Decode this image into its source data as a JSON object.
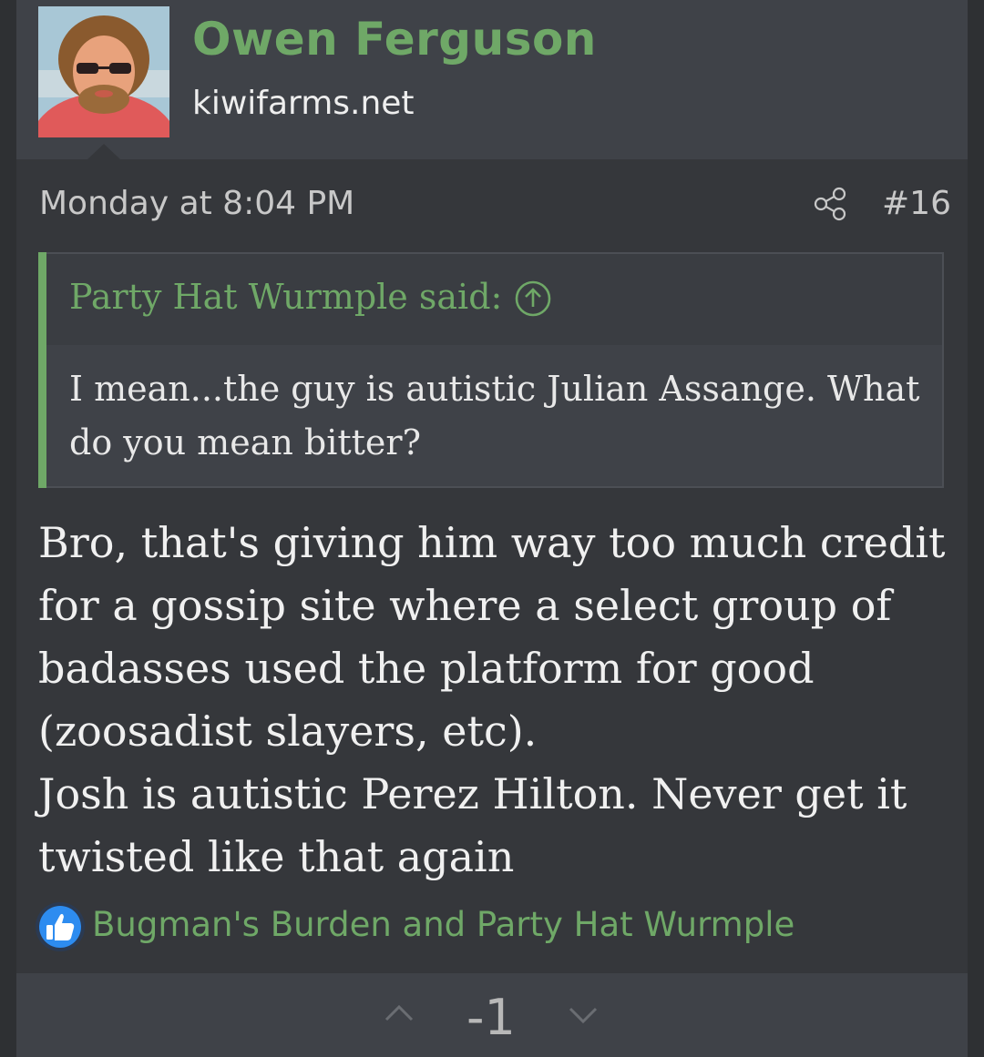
{
  "author": {
    "name": "Owen Ferguson",
    "title": "kiwifarms.net"
  },
  "post": {
    "date": "Monday at 8:04 PM",
    "number": "#16"
  },
  "quote": {
    "author_line": "Party Hat Wurmple said:",
    "text": "I mean...the guy is autistic Julian Assange. What do you mean bitter?"
  },
  "body": {
    "paragraph_1": "Bro, that's giving him way too much credit for a gossip site where a select group of badasses used the platform for good (zoosadist slayers, etc).",
    "paragraph_2": "Josh is autistic Perez Hilton. Never get it twisted like that again"
  },
  "reactions": {
    "icon": "thumbs-up-icon",
    "users": "Bugman's Burden and Party Hat Wurmple"
  },
  "vote": {
    "score": "-1"
  },
  "colors": {
    "accent": "#6fa867",
    "background": "#35373b",
    "header_bg": "#3f4248"
  },
  "icons": {
    "share": "share-icon",
    "quote_jump": "arrow-up-circle-icon",
    "upvote": "chevron-up-icon",
    "downvote": "chevron-down-icon"
  }
}
